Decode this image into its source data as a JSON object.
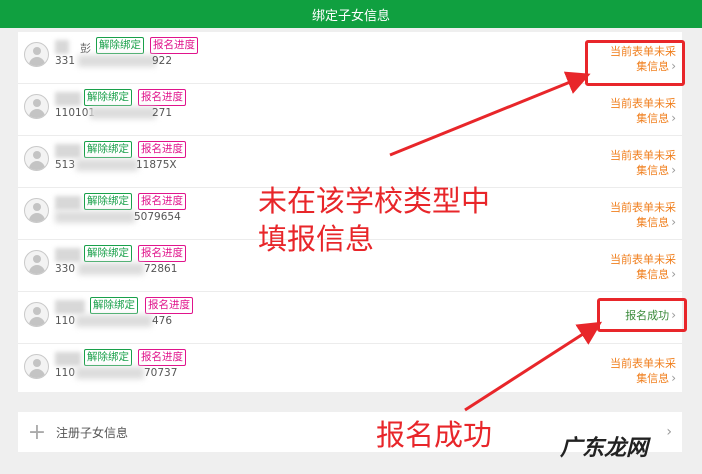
{
  "header": {
    "title": "绑定子女信息"
  },
  "children": [
    {
      "name_visible": "",
      "id_prefix": "331",
      "id_suffix": "922",
      "unbind": "解除绑定",
      "progress": "报名进度",
      "status": "当前表单未采集信息",
      "status_line1": "当前表单未采",
      "status_line2": "集信息",
      "ok": false
    },
    {
      "name_visible": "",
      "id_prefix": "110101",
      "id_suffix": "271",
      "unbind": "解除绑定",
      "progress": "报名进度",
      "status": "当前表单未采集信息",
      "status_line1": "当前表单未采",
      "status_line2": "集信息",
      "ok": false
    },
    {
      "name_visible": "",
      "id_prefix": "513",
      "id_suffix": "11875X",
      "unbind": "解除绑定",
      "progress": "报名进度",
      "status": "当前表单未采集信息",
      "status_line1": "当前表单未采",
      "status_line2": "集信息",
      "ok": false
    },
    {
      "name_visible": "",
      "id_prefix": "",
      "id_suffix": "5079654",
      "unbind": "解除绑定",
      "progress": "报名进度",
      "status": "当前表单未采集信息",
      "status_line1": "当前表单未采",
      "status_line2": "集信息",
      "ok": false
    },
    {
      "name_visible": "",
      "id_prefix": "330",
      "id_suffix": "72861",
      "unbind": "解除绑定",
      "progress": "报名进度",
      "status": "当前表单未采集信息",
      "status_line1": "当前表单未采",
      "status_line2": "集信息",
      "ok": false
    },
    {
      "name_visible": "",
      "id_prefix": "110",
      "id_suffix": "476",
      "unbind": "解除绑定",
      "progress": "报名进度",
      "status": "报名成功",
      "ok": true
    },
    {
      "name_visible": "",
      "id_prefix": "110",
      "id_suffix": "70737",
      "unbind": "解除绑定",
      "progress": "报名进度",
      "status": "当前表单未采集信息",
      "status_line1": "当前表单未采",
      "status_line2": "集信息",
      "ok": false
    }
  ],
  "first_row_name_char": "彭",
  "add_child": {
    "label": "注册子女信息"
  },
  "annotations": {
    "not_filled_line1": "未在该学校类型中",
    "not_filled_line2": "填报信息",
    "success": "报名成功"
  },
  "watermark": "广东龙网",
  "colors": {
    "header_green": "#10a040",
    "unbind_green": "#19a04a",
    "progress_pink": "#e0148c",
    "status_orange": "#f08020",
    "annotation_red": "#e8262a"
  },
  "icons": [
    "avatar-icon",
    "chevron-right-icon",
    "plus-icon"
  ]
}
